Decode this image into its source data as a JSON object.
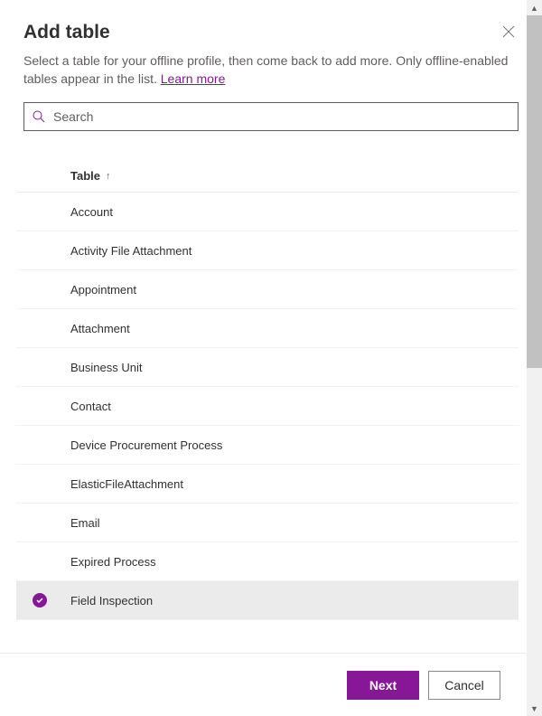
{
  "header": {
    "title": "Add table",
    "description_prefix": "Select a table for your offline profile, then come back to add more. Only offline-enabled tables appear in the list. ",
    "learn_more": "Learn more",
    "learn_more_href": "#"
  },
  "search": {
    "placeholder": "Search",
    "value": ""
  },
  "table": {
    "header_label": "Table",
    "sort_direction": "asc",
    "rows": [
      {
        "label": "Account",
        "selected": false
      },
      {
        "label": "Activity File Attachment",
        "selected": false
      },
      {
        "label": "Appointment",
        "selected": false
      },
      {
        "label": "Attachment",
        "selected": false
      },
      {
        "label": "Business Unit",
        "selected": false
      },
      {
        "label": "Contact",
        "selected": false
      },
      {
        "label": "Device Procurement Process",
        "selected": false
      },
      {
        "label": "ElasticFileAttachment",
        "selected": false
      },
      {
        "label": "Email",
        "selected": false
      },
      {
        "label": "Expired Process",
        "selected": false
      },
      {
        "label": "Field Inspection",
        "selected": true
      }
    ]
  },
  "footer": {
    "primary": "Next",
    "secondary": "Cancel"
  },
  "colors": {
    "accent": "#881798"
  }
}
